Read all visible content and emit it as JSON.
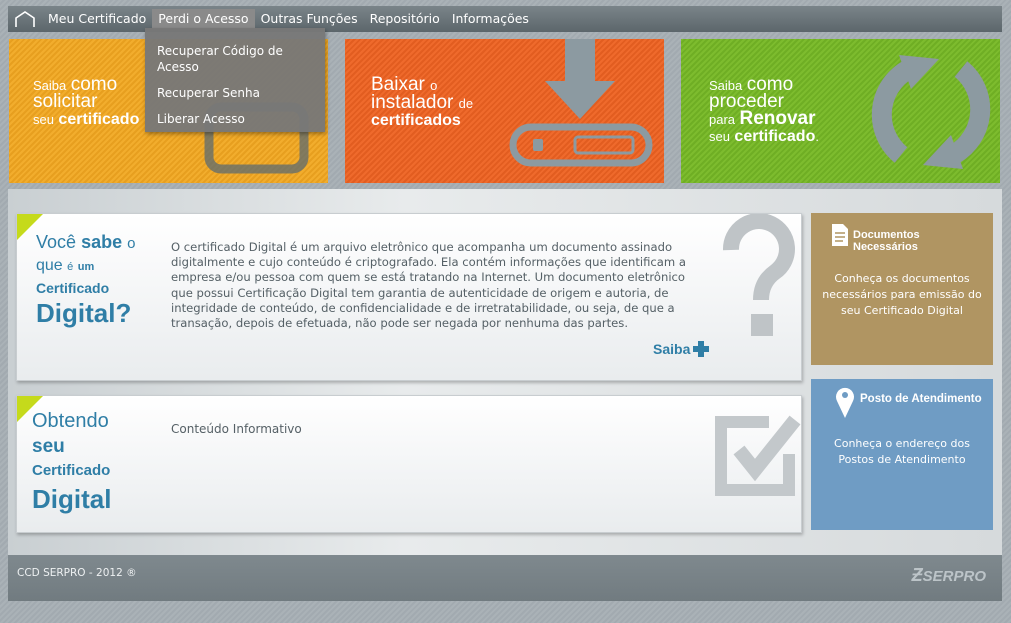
{
  "nav": {
    "home_icon": "home-icon",
    "items": [
      "Meu Certificado",
      "Perdi o Acesso",
      "Outras Funções",
      "Repositório",
      "Informações"
    ],
    "active_index": 1,
    "dropdown": [
      "Recuperar Código de",
      "Acesso",
      "Recuperar Senha",
      "Liberar Acesso"
    ]
  },
  "banners": {
    "solicitar": {
      "l1a": "Saiba",
      "l1b": "como",
      "l2": "solicitar",
      "l3a": "seu",
      "l3b": "certificado"
    },
    "baixar": {
      "l1a": "Baixar",
      "l1b": "o",
      "l2a": "instalador",
      "l2b": "de",
      "l3": "certificados"
    },
    "renovar": {
      "l1a": "Saiba",
      "l1b": "como",
      "l2": "proceder",
      "l3a": "para",
      "l3b": "Renovar",
      "l4a": "seu",
      "l4b": "certificado",
      "l4c": "."
    }
  },
  "card1": {
    "title": {
      "l1a": "Você",
      "l1b": "sabe",
      "l1c": "o",
      "l2a": "que",
      "l2b": "é",
      "l2c": "um",
      "l3": "Certificado",
      "l4": "Digital?"
    },
    "body": [
      "O certificado Digital é um arquivo eletrônico que acompanha um documento assinado",
      "digitalmente e cujo conteúdo é criptografado. Ela contém informações que identificam a",
      "empresa e/ou pessoa com quem se está tratando na Internet. Um documento eletrônico",
      "que possui Certificação Digital tem garantia de autenticidade de origem e autoria, de",
      "integridade de conteúdo, de confidencialidade e de irretratabilidade, ou seja, de que a",
      "transação, depois de efetuada, não pode ser negada por nenhuma das partes."
    ],
    "saiba": "Saiba"
  },
  "card2": {
    "title": {
      "l1": "Obtendo",
      "l2": "seu",
      "l3": "Certificado",
      "l4": "Digital"
    },
    "body": "Conteúdo Informativo"
  },
  "side1": {
    "title_l1": "Documentos",
    "title_l2": "Necessários",
    "text": [
      "Conheça os documentos",
      "necessários para emissão do",
      "seu Certificado Digital"
    ],
    "color": "#b09562"
  },
  "side2": {
    "title": "Posto de Atendimento",
    "text": [
      "Conheça o endereço dos",
      "Postos de Atendimento"
    ],
    "color": "#6f9cc4"
  },
  "footer": {
    "copyright": "CCD SERPRO - 2012 ®",
    "logo": "SERPRO"
  }
}
